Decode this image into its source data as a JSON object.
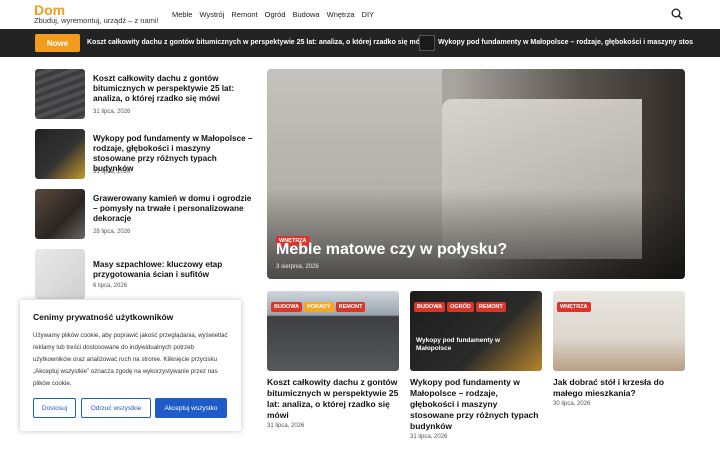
{
  "header": {
    "logo": "Dom",
    "tagline": "Zbuduj, wyremontuj, urządź – z nami!",
    "nav": [
      "Meble",
      "Wystrój",
      "Remont",
      "Ogród",
      "Budowa",
      "Wnętrza",
      "DIY"
    ]
  },
  "ticker": {
    "badge": "Nowe",
    "items": [
      "Koszt całkowity dachu z gontów bitumicznych w perspektywie 25 lat: analiza, o której rzadko się mówi",
      "Wykopy pod fundamenty w Małopolsce – rodzaje, głębokości i maszyny stos"
    ]
  },
  "sidebar_list": [
    {
      "title": "Koszt całkowity dachu z gontów bitumicznych w perspektywie 25 lat: analiza, o której rzadko się mówi",
      "date": "31 lipca, 2026"
    },
    {
      "title": "Wykopy pod fundamenty w Małopolsce – rodzaje, głębokości i maszyny stosowane przy różnych typach budynków",
      "date": "31 lipca, 2026"
    },
    {
      "title": "Grawerowany kamień w domu i ogrodzie – pomysły na trwałe i personalizowane dekoracje",
      "date": "28 lipca, 2026"
    },
    {
      "title": "Masy szpachlowe: kluczowy etap przygotowania ścian i sufitów",
      "date": "6 lipca, 2026"
    }
  ],
  "hero": {
    "tag": "Wnętrza",
    "title": "Meble matowe czy w połysku?",
    "date": "3 sierpnia, 2026"
  },
  "cards": [
    {
      "tags": [
        "Budowa",
        "Poradý",
        "Remont"
      ],
      "title": "Koszt całkowity dachu z gontów bitumicznych w perspektywie 25 lat: analiza, o której rzadko się mówi",
      "date": "31 lipca, 2026"
    },
    {
      "tags": [
        "Budowa",
        "Ogród",
        "Remont"
      ],
      "title": "Wykopy pod fundamenty w Małopolsce – rodzaje, głębokości i maszyny stosowane przy różnych typach budynków",
      "date": "31 lipca, 2026",
      "image_text": "Wykopy pod fundamenty w Małopolsce"
    },
    {
      "tags": [
        "Wnętrza"
      ],
      "title": "Jak dobrać stół i krzesła do małego mieszkania?",
      "date": "30 lipca, 2026"
    }
  ],
  "cookie": {
    "title": "Cenimy prywatność użytkowników",
    "text": "Używamy plików cookie, aby poprawić jakość przeglądania, wyświetlać reklamy lub treści dostosowane do indywidualnych potrzeb użytkowników oraz analizować ruch na stronie. Kliknięcie przycisku „Akceptuj wszystkie” oznacza zgodę na wykorzystywanie przez nas plików cookie.",
    "btn_customize": "Dostosuj",
    "btn_reject": "Odrzuć wszystkie",
    "btn_accept": "Akceptuj wszystko"
  },
  "partial_title": "w"
}
